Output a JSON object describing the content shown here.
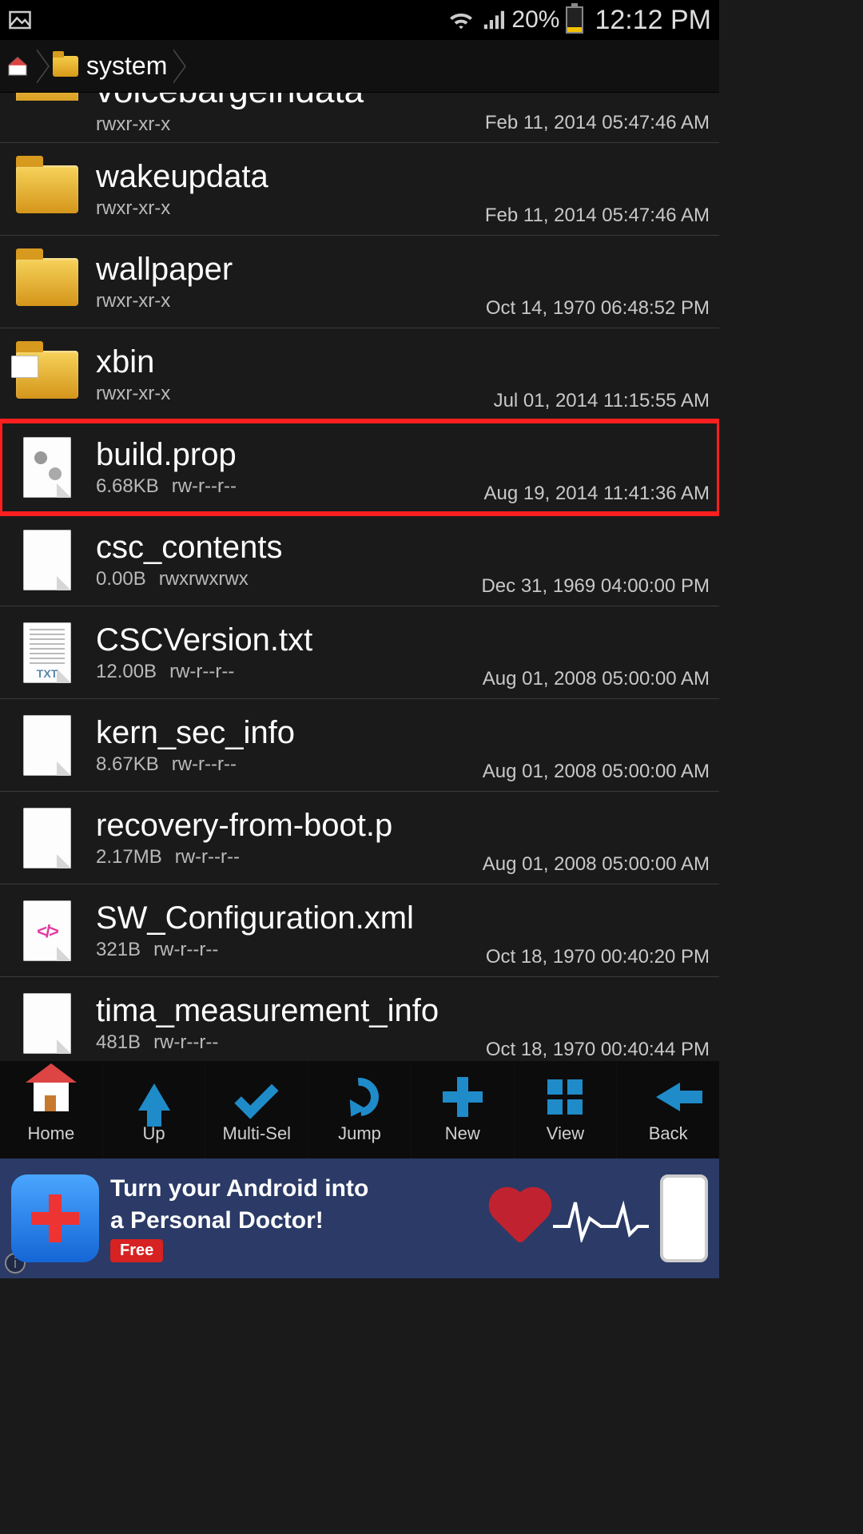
{
  "status": {
    "battery_pct": "20%",
    "time": "12:12 PM"
  },
  "breadcrumb": {
    "path": "system"
  },
  "files": [
    {
      "name": "voicebargeindata",
      "perm": "rwxr-xr-x",
      "size": "",
      "date": "Feb 11, 2014 05:47:46 AM",
      "icon": "folder",
      "partial": true
    },
    {
      "name": "wakeupdata",
      "perm": "rwxr-xr-x",
      "size": "",
      "date": "Feb 11, 2014 05:47:46 AM",
      "icon": "folder"
    },
    {
      "name": "wallpaper",
      "perm": "rwxr-xr-x",
      "size": "",
      "date": "Oct 14, 1970 06:48:52 PM",
      "icon": "folder"
    },
    {
      "name": "xbin",
      "perm": "rwxr-xr-x",
      "size": "",
      "date": "Jul 01, 2014 11:15:55 AM",
      "icon": "folder-overlay"
    },
    {
      "name": "build.prop",
      "perm": "rw-r--r--",
      "size": "6.68KB",
      "date": "Aug 19, 2014 11:41:36 AM",
      "icon": "file-gears",
      "highlight": true
    },
    {
      "name": "csc_contents",
      "perm": "rwxrwxrwx",
      "size": "0.00B",
      "date": "Dec 31, 1969 04:00:00 PM",
      "icon": "file"
    },
    {
      "name": "CSCVersion.txt",
      "perm": "rw-r--r--",
      "size": "12.00B",
      "date": "Aug 01, 2008 05:00:00 AM",
      "icon": "file-txt"
    },
    {
      "name": "kern_sec_info",
      "perm": "rw-r--r--",
      "size": "8.67KB",
      "date": "Aug 01, 2008 05:00:00 AM",
      "icon": "file"
    },
    {
      "name": "recovery-from-boot.p",
      "perm": "rw-r--r--",
      "size": "2.17MB",
      "date": "Aug 01, 2008 05:00:00 AM",
      "icon": "file"
    },
    {
      "name": "SW_Configuration.xml",
      "perm": "rw-r--r--",
      "size": "321B",
      "date": "Oct 18, 1970 00:40:20 PM",
      "icon": "file-xml"
    },
    {
      "name": "tima_measurement_info",
      "perm": "rw-r--r--",
      "size": "481B",
      "date": "Oct 18, 1970 00:40:44 PM",
      "icon": "file"
    }
  ],
  "toolbar": {
    "home": "Home",
    "up": "Up",
    "multisel": "Multi-Sel",
    "jump": "Jump",
    "new": "New",
    "view": "View",
    "back": "Back"
  },
  "ad": {
    "line1": "Turn your Android into",
    "line2": "a Personal Doctor!",
    "badge": "Free"
  },
  "txt_badge": "TXT",
  "xml_badge": "</>"
}
